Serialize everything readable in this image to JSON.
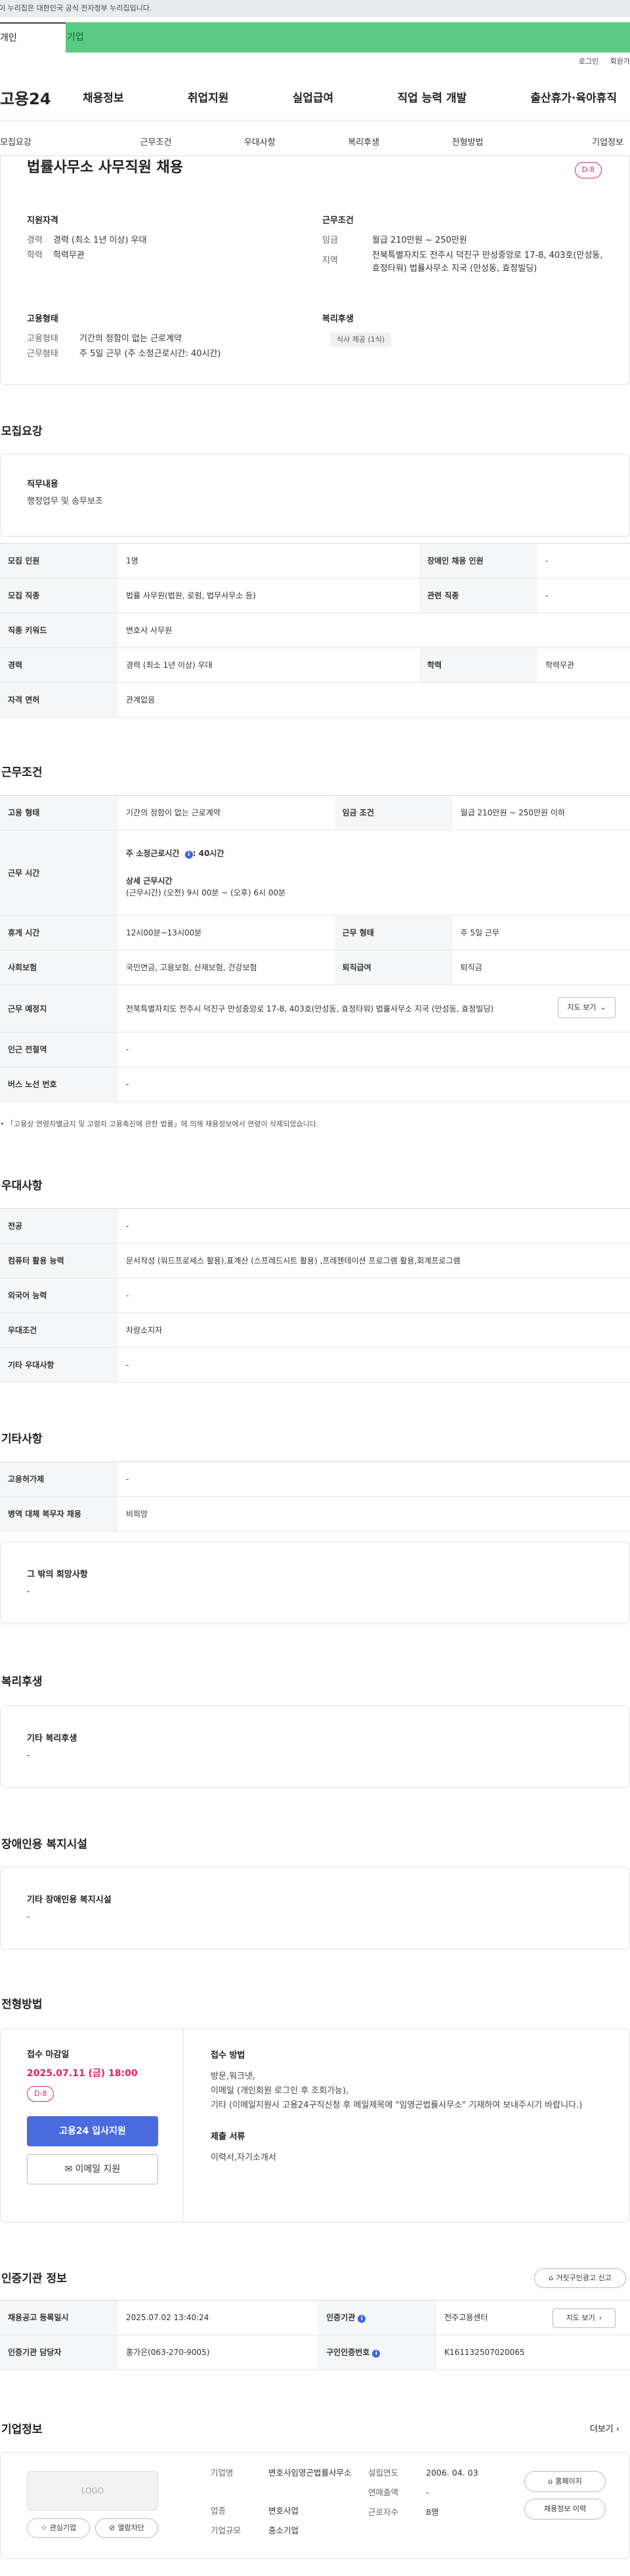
{
  "topbar": {
    "text": "이 누리집은 대한민국 공식 전자정부 누리집입니다."
  },
  "tabs": {
    "person": "개인",
    "biz": "기업"
  },
  "util": {
    "login": "로그인",
    "join": "회원가"
  },
  "gnb": {
    "logo": "고용24",
    "menu": [
      "채용정보",
      "취업지원",
      "실업급여",
      "직업 능력 개발",
      "출산휴가·육아휴직"
    ]
  },
  "subnav": [
    "모집요강",
    "근무조건",
    "우대사항",
    "복리후생",
    "전형방법",
    "기업정보"
  ],
  "summary": {
    "title": "법률사무소 사무직원 채용",
    "dday": "D-8",
    "qual_title": "지원자격",
    "qual": [
      {
        "k": "경력",
        "v": "경력 (최소 1년 이상) 우대"
      },
      {
        "k": "학력",
        "v": "학력무관"
      }
    ],
    "cond_title": "근무조건",
    "cond": [
      {
        "k": "임금",
        "v": "월급 210만원 ~ 250만원"
      },
      {
        "k": "지역",
        "v": "전북특별자치도 전주시 덕진구 만성중앙로 17-8, 403호(만성동, 효정타워) 법률사무소 지국 (만성동, 효정빌딩)"
      }
    ],
    "emp_title": "고용형태",
    "emp": [
      {
        "k": "고용형태",
        "v": "기간의 정함이 없는 근로계약"
      },
      {
        "k": "근무형태",
        "v": "주 5일 근무 (주 소정근로시간: 40시간)"
      }
    ],
    "welfare_title": "복리후생",
    "welfare_chip": "식사 제공 (1식)"
  },
  "recruit": {
    "title": "모집요강",
    "job_title": "직무내용",
    "job_desc": "행정업무 및 송무보조",
    "rows": [
      {
        "h1": "모집 인원",
        "v1": "1명",
        "h2": "장애인 채용 인원",
        "v2": "-"
      },
      {
        "h1": "모집 직종",
        "v1": "법률 사무원(법원, 로펌, 법무사무소 등)",
        "h2": "관련 직종",
        "v2": "-"
      },
      {
        "h1": "직종 키워드",
        "v1": "변호사 사무원"
      },
      {
        "h1": "경력",
        "v1": "경력 (최소 1년 이상) 우대",
        "h2": "학력",
        "v2": "학력무관"
      },
      {
        "h1": "자격 면허",
        "v1": "관계없음"
      }
    ]
  },
  "work": {
    "title": "근무조건",
    "r1": {
      "h1": "고용 형태",
      "v1": "기간의 정함이 없는 근로계약",
      "h2": "임금 조건",
      "v2": "월급 210만원 ~ 250만원 이하"
    },
    "time": {
      "h": "근무 시간",
      "main": "주 소정근로시간",
      "main_val": ": 40시간",
      "sub": "상세 근무시간",
      "detail": "(근무시간) (오전) 9시 00분 ~ (오후) 6시 00분"
    },
    "r3": {
      "h1": "휴게 시간",
      "v1": "12시00분~13시00분",
      "h2": "근무 형태",
      "v2": "주 5일 근무"
    },
    "r4": {
      "h1": "사회보험",
      "v1": "국민연금, 고용보험, 산재보험, 건강보험",
      "h2": "퇴직급여",
      "v2": "퇴직금"
    },
    "r5": {
      "h": "근무 예정지",
      "v": "전북특별자치도 전주시 덕진구 만성중앙로 17-8, 403호(만성동, 효정타워) 법률사무소 지국 (만성동, 효정빌딩)",
      "map": "지도 보기"
    },
    "r6": {
      "h": "인근 전철역",
      "v": "-"
    },
    "r7": {
      "h": "버스 노선 번호",
      "v": "-"
    },
    "note": "「고용상 연령차별금지 및 고령자 고용촉진에 관한 법률」에 의해 채용정보에서 연령이 삭제되었습니다."
  },
  "pref": {
    "title": "우대사항",
    "rows": [
      {
        "h": "전공",
        "v": "-"
      },
      {
        "h": "컴퓨터 활용 능력",
        "v": "문서작성 (워드프로세스 활용),표계산 (스프레드시트 활용) ,프레젠테이션 프로그램 활용,회계프로그램"
      },
      {
        "h": "외국어 능력",
        "v": "-"
      },
      {
        "h": "우대조건",
        "v": "차량소지자"
      },
      {
        "h": "기타 우대사항",
        "v": "-"
      }
    ]
  },
  "etc": {
    "title": "기타사항",
    "rows": [
      {
        "h": "고용허가제",
        "v": "-"
      },
      {
        "h": "병역 대체 복무자 채용",
        "v": "비희망"
      }
    ],
    "hope_title": "그 밖의 희망사항",
    "hope": "-"
  },
  "welfare": {
    "title": "복리후생",
    "t": "기타 복리후생",
    "d": "-"
  },
  "disabled": {
    "title": "장애인용 복지시설",
    "t": "기타 장애인용 복지시설",
    "d": "-"
  },
  "process": {
    "title": "전형방법",
    "deadline_t": "접수 마감일",
    "deadline": "2025.07.11 (금) 18:00",
    "dday": "D-8",
    "apply_btn": "고용24 입사지원",
    "email_btn": "이메일 지원",
    "method_t": "접수 방법",
    "method": [
      "방문,워크넷,",
      "이메일 (개인회원 로그인 후 조회가능),",
      "기타 (이메일지원시 고용24구직신청 후 메일제목에 \"임영곤법률사무소\" 기재하여 보내주시기 바랍니다.)"
    ],
    "docs_t": "제출 서류",
    "docs": "이력서,자기소개서"
  },
  "cert": {
    "title": "인증기관 정보",
    "report_btn": "거짓구인광고 신고",
    "rows": [
      {
        "h1": "채용공고 등록일시",
        "v1": "2025.07.02 13:40:24",
        "h2": "인증기관",
        "v2": "전주고용센터",
        "btn": "지도 보기"
      },
      {
        "h1": "인증기관 담당자",
        "v1": "홍가은(063-270-9005)",
        "h2": "구인인증번호",
        "v2": "K161132507020065"
      }
    ]
  },
  "company": {
    "title": "기업정보",
    "more": "더보기",
    "logo": "LOGO",
    "fav_btn": "관심기업",
    "block_btn": "열람차단",
    "name_k": "기업명",
    "name_v": "변호사임영곤법률사무소",
    "ind_k": "업종",
    "ind_v": "변호사업",
    "scale_k": "기업규모",
    "scale_v": "중소기업",
    "est_k": "설립연도",
    "est_v": "2006. 04. 03",
    "sales_k": "연매출액",
    "sales_v": "-",
    "emp_k": "근로자수",
    "emp_v": "8명",
    "home_btn": "홈페이지",
    "hist_btn": "채용정보 이력"
  }
}
